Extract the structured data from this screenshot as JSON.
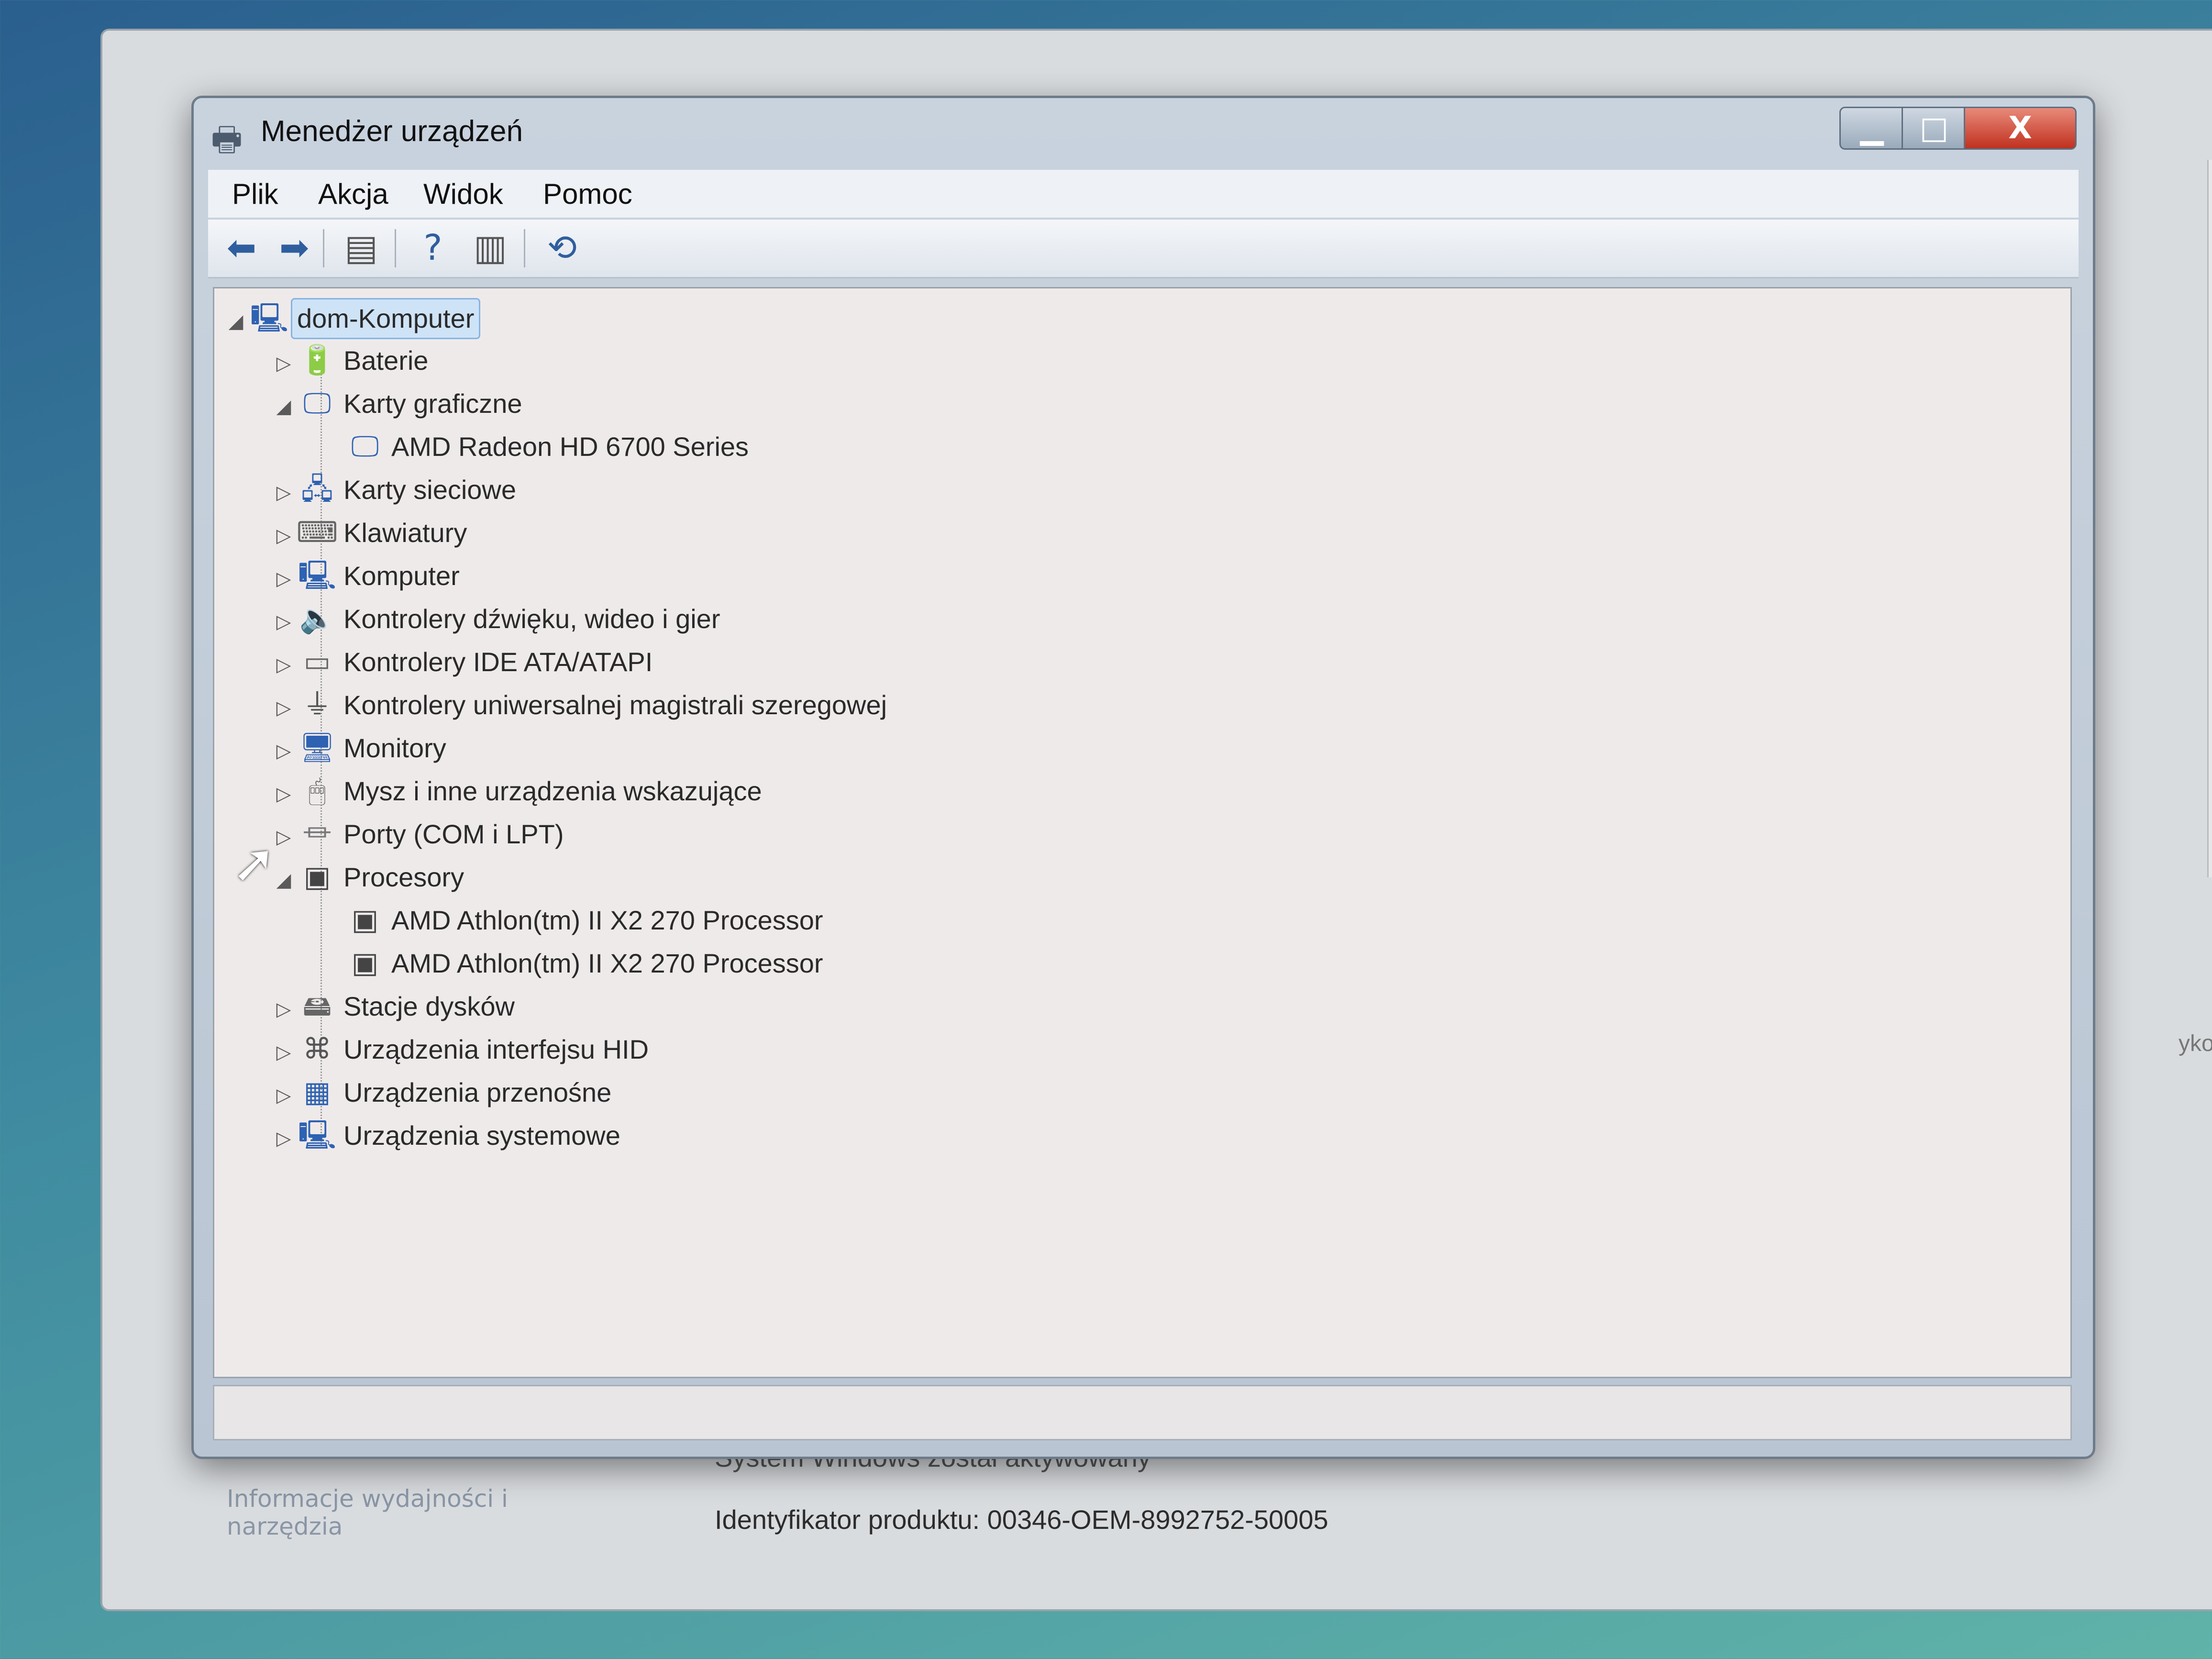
{
  "window": {
    "title": "Menedżer urządzeń",
    "controls": {
      "minimize": "▁",
      "maximize": "□",
      "close": "X"
    }
  },
  "menu": [
    "Plik",
    "Akcja",
    "Widok",
    "Pomoc"
  ],
  "toolbar_icons": [
    "back-arrow-icon",
    "forward-arrow-icon",
    "properties-icon",
    "help-icon",
    "view-icon",
    "scan-hardware-icon"
  ],
  "tree": {
    "root": "dom-Komputer",
    "nodes": [
      {
        "label": "Baterie",
        "icon": "battery-icon",
        "expanded": false,
        "children": []
      },
      {
        "label": "Karty graficzne",
        "icon": "display-adapter-icon",
        "expanded": true,
        "children": [
          "AMD Radeon HD 6700 Series"
        ]
      },
      {
        "label": "Karty sieciowe",
        "icon": "network-icon",
        "expanded": false,
        "children": []
      },
      {
        "label": "Klawiatury",
        "icon": "keyboard-icon",
        "expanded": false,
        "children": []
      },
      {
        "label": "Komputer",
        "icon": "computer-icon",
        "expanded": false,
        "children": []
      },
      {
        "label": "Kontrolery dźwięku, wideo i gier",
        "icon": "speaker-icon",
        "expanded": false,
        "children": []
      },
      {
        "label": "Kontrolery IDE ATA/ATAPI",
        "icon": "ide-controller-icon",
        "expanded": false,
        "children": []
      },
      {
        "label": "Kontrolery uniwersalnej magistrali szeregowej",
        "icon": "usb-icon",
        "expanded": false,
        "children": []
      },
      {
        "label": "Monitory",
        "icon": "monitor-icon",
        "expanded": false,
        "children": []
      },
      {
        "label": "Mysz i inne urządzenia wskazujące",
        "icon": "mouse-icon",
        "expanded": false,
        "children": []
      },
      {
        "label": "Porty (COM i LPT)",
        "icon": "port-icon",
        "expanded": false,
        "children": []
      },
      {
        "label": "Procesory",
        "icon": "processor-icon",
        "expanded": true,
        "children": [
          "AMD Athlon(tm) II X2 270 Processor",
          "AMD Athlon(tm) II X2 270 Processor"
        ]
      },
      {
        "label": "Stacje dysków",
        "icon": "disk-drive-icon",
        "expanded": false,
        "children": []
      },
      {
        "label": "Urządzenia interfejsu HID",
        "icon": "hid-icon",
        "expanded": false,
        "children": []
      },
      {
        "label": "Urządzenia przenośne",
        "icon": "portable-device-icon",
        "expanded": false,
        "children": []
      },
      {
        "label": "Urządzenia systemowe",
        "icon": "system-device-icon",
        "expanded": false,
        "children": []
      }
    ]
  },
  "background": {
    "partial_status": "System Windows został aktywowany",
    "product_id": "Identyfikator produktu: 00346-OEM-8992752-50005",
    "sidebar_link": "Informacje wydajności i narzędzia",
    "right_fragment": "ykowego"
  }
}
